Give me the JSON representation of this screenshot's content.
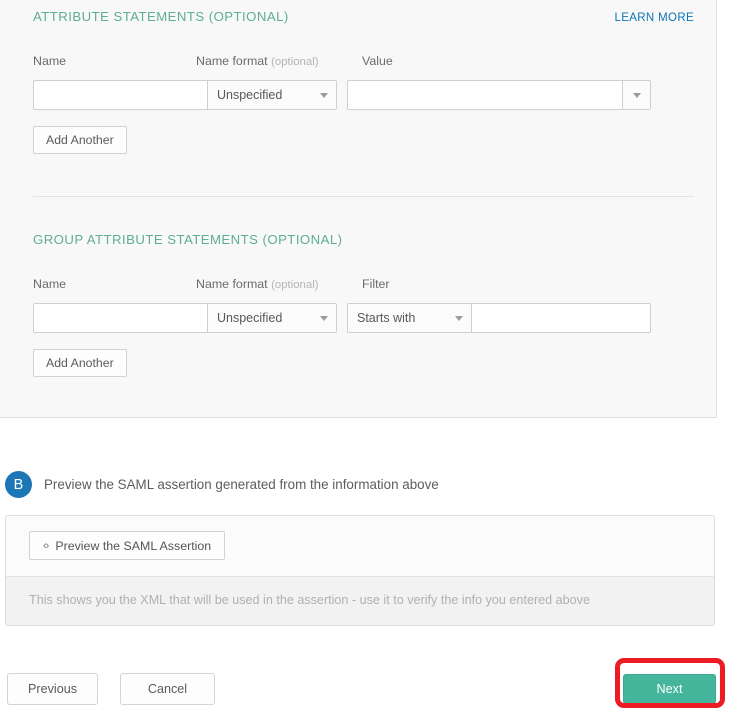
{
  "attribute_section": {
    "title": "ATTRIBUTE STATEMENTS (OPTIONAL)",
    "learn_more": "LEARN MORE",
    "labels": {
      "name": "Name",
      "name_format": "Name format",
      "name_format_optional": "(optional)",
      "value": "Value"
    },
    "row": {
      "name_value": "",
      "name_placeholder": "",
      "format_selected": "Unspecified",
      "value_value": "",
      "value_placeholder": ""
    },
    "add_another": "Add Another"
  },
  "group_section": {
    "title": "GROUP ATTRIBUTE STATEMENTS (OPTIONAL)",
    "labels": {
      "name": "Name",
      "name_format": "Name format",
      "name_format_optional": "(optional)",
      "filter": "Filter"
    },
    "row": {
      "name_value": "",
      "name_placeholder": "",
      "format_selected": "Unspecified",
      "filter_selected": "Starts with",
      "filter_value": "",
      "filter_placeholder": ""
    },
    "add_another": "Add Another"
  },
  "step_b": {
    "badge": "B",
    "text": "Preview the SAML assertion generated from the information above"
  },
  "preview_card": {
    "button_label": "Preview the SAML Assertion",
    "code_icon": "‹›",
    "hint": "This shows you the XML that will be used in the assertion - use it to verify the info you entered above"
  },
  "footer": {
    "previous": "Previous",
    "cancel": "Cancel",
    "next": "Next"
  },
  "colors": {
    "section_heading": "#5eaf8e",
    "link": "#0c75b5",
    "badge": "#1d77b6",
    "primary_button": "#45b69b",
    "highlight": "#ed1c24"
  }
}
